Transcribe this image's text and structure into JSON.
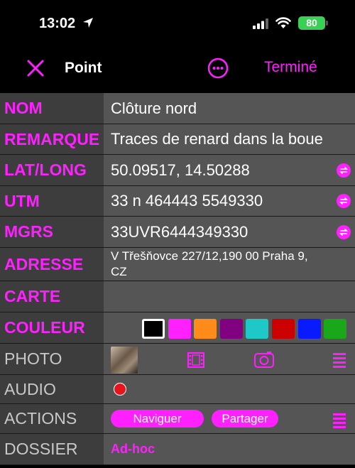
{
  "status": {
    "time": "13:02",
    "battery": "80"
  },
  "nav": {
    "title": "Point",
    "done_label": "Terminé"
  },
  "fields": {
    "nom": {
      "label": "NOM",
      "value": "Clôture nord"
    },
    "remarque": {
      "label": "REMARQUE",
      "value": "Traces de renard dans la boue"
    },
    "latlong": {
      "label": "LAT/LONG",
      "value": "50.09517, 14.50288"
    },
    "utm": {
      "label": "UTM",
      "value": "33 n 464443 5549330"
    },
    "mgrs": {
      "label": "MGRS",
      "value": "33UVR6444349330"
    },
    "adresse": {
      "label": "ADRESSE",
      "value": "V Třešňovce 227/12,190 00 Praha 9, CZ"
    },
    "carte": {
      "label": "CARTE",
      "value": ""
    },
    "couleur": {
      "label": "COULEUR"
    },
    "photo": {
      "label": "PHOTO"
    },
    "audio": {
      "label": "AUDIO"
    },
    "actions": {
      "label": "ACTIONS",
      "navigate_label": "Naviguer",
      "share_label": "Partager"
    },
    "dossier": {
      "label": "DOSSIER",
      "value": "Ad-hoc"
    }
  },
  "colors": {
    "accent": "#ff20ff",
    "swatches": [
      "#000000",
      "#ff20ff",
      "#ff8c1a",
      "#800080",
      "#1ec8c8",
      "#cc0000",
      "#0a1aff",
      "#1aa81a"
    ],
    "selected_index": 0
  },
  "icons": {
    "close": "close-icon",
    "more": "ellipsis-circle-icon",
    "convert": "convert-arrows-icon",
    "film": "film-icon",
    "camera": "camera-icon",
    "list": "list-icon",
    "record": "record-icon"
  }
}
